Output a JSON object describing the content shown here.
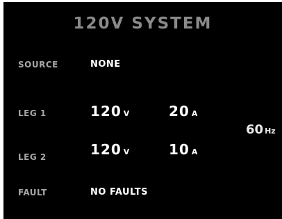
{
  "title": "120V SYSTEM",
  "source": {
    "label": "SOURCE",
    "value": "NONE"
  },
  "leg1": {
    "label": "LEG 1",
    "voltage": "120",
    "voltage_unit": "V",
    "current": "20",
    "current_unit": "A"
  },
  "leg2": {
    "label": "LEG 2",
    "voltage": "120",
    "voltage_unit": "V",
    "current": "10",
    "current_unit": "A"
  },
  "frequency": {
    "value": "60",
    "unit": "Hz"
  },
  "fault": {
    "label": "FAULT",
    "value": "NO FAULTS"
  }
}
